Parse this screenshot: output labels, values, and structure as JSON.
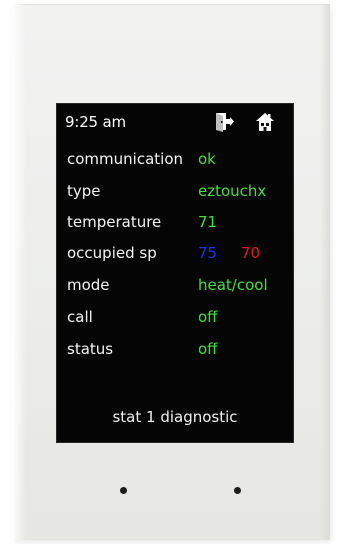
{
  "status_bar": {
    "time": "9:25 am",
    "icons": [
      "door-exit-icon",
      "home-icon"
    ]
  },
  "rows": {
    "communication": {
      "label": "communication",
      "value": "ok"
    },
    "type": {
      "label": "type",
      "value": "eztouchx"
    },
    "temperature": {
      "label": "temperature",
      "value": "71"
    },
    "occupied_sp": {
      "label": "occupied sp",
      "cool_value": "75",
      "heat_value": "70"
    },
    "mode": {
      "label": "mode",
      "value": "heat/cool"
    },
    "call": {
      "label": "call",
      "value": "off"
    },
    "status": {
      "label": "status",
      "value": "off"
    }
  },
  "footer": {
    "title": "stat 1 diagnostic"
  },
  "colors": {
    "screen_bg": "#050505",
    "value_green": "#3fe23a",
    "cool_blue": "#1f2fe6",
    "heat_red": "#e81818",
    "label_white": "#f4f4f4"
  }
}
